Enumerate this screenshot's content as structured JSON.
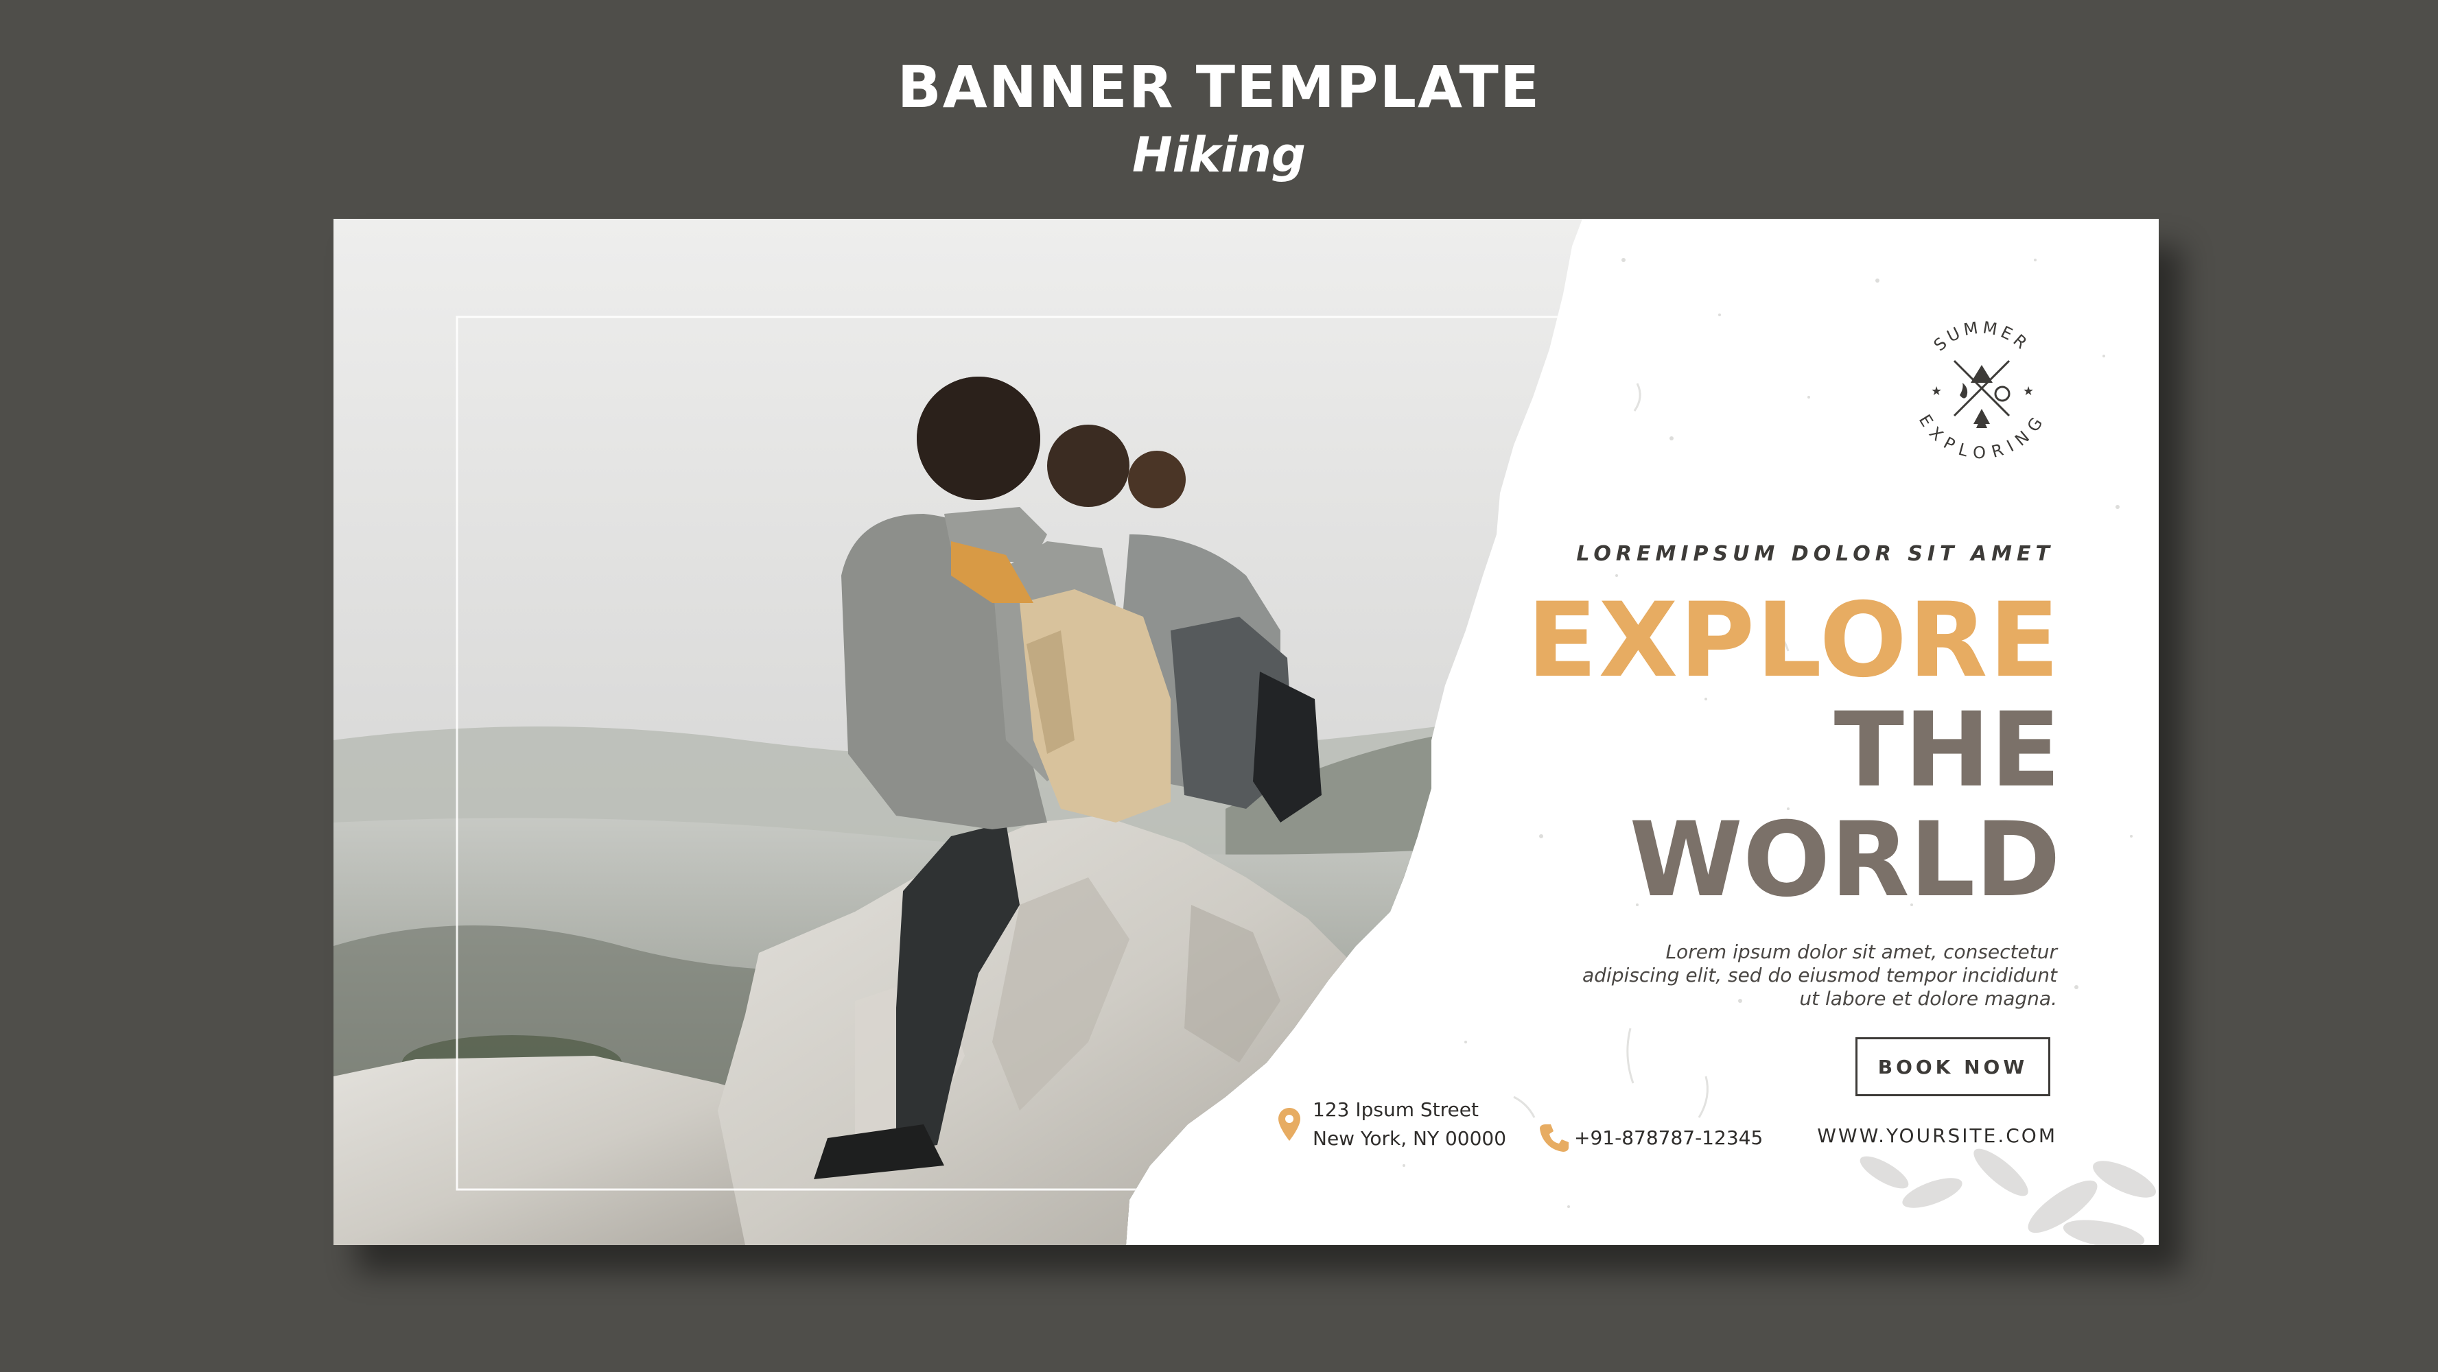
{
  "header": {
    "title": "BANNER TEMPLATE",
    "subtitle": "Hiking"
  },
  "banner": {
    "logo": {
      "top_text": "SUMMER",
      "bottom_text": "EXPLORING",
      "icon": "tent-campfire-compass-pine-emblem"
    },
    "tagline": "LOREMIPSUM DOLOR SIT AMET",
    "headline": {
      "line1": "EXPLORE",
      "line2": "THE",
      "line3": "WORLD"
    },
    "description": "Lorem ipsum dolor sit amet, consectetur adipiscing elit, sed do eiusmod tempor incididunt ut labore et dolore magna.",
    "cta_label": "BOOK NOW",
    "contact": {
      "address_line1": "123 Ipsum Street",
      "address_line2": "New York, NY 00000",
      "address_icon": "map-pin-icon",
      "phone": "+91-878787-12345",
      "phone_icon": "phone-icon",
      "website": "WWW.YOURSITE.COM"
    },
    "photo": "hikers-sitting-on-mountain-rock"
  },
  "colors": {
    "page_background": "#4f4e4a",
    "accent_orange": "#e7ac62",
    "headline_gray": "#7b7169",
    "text_dark": "#3d3b38"
  }
}
